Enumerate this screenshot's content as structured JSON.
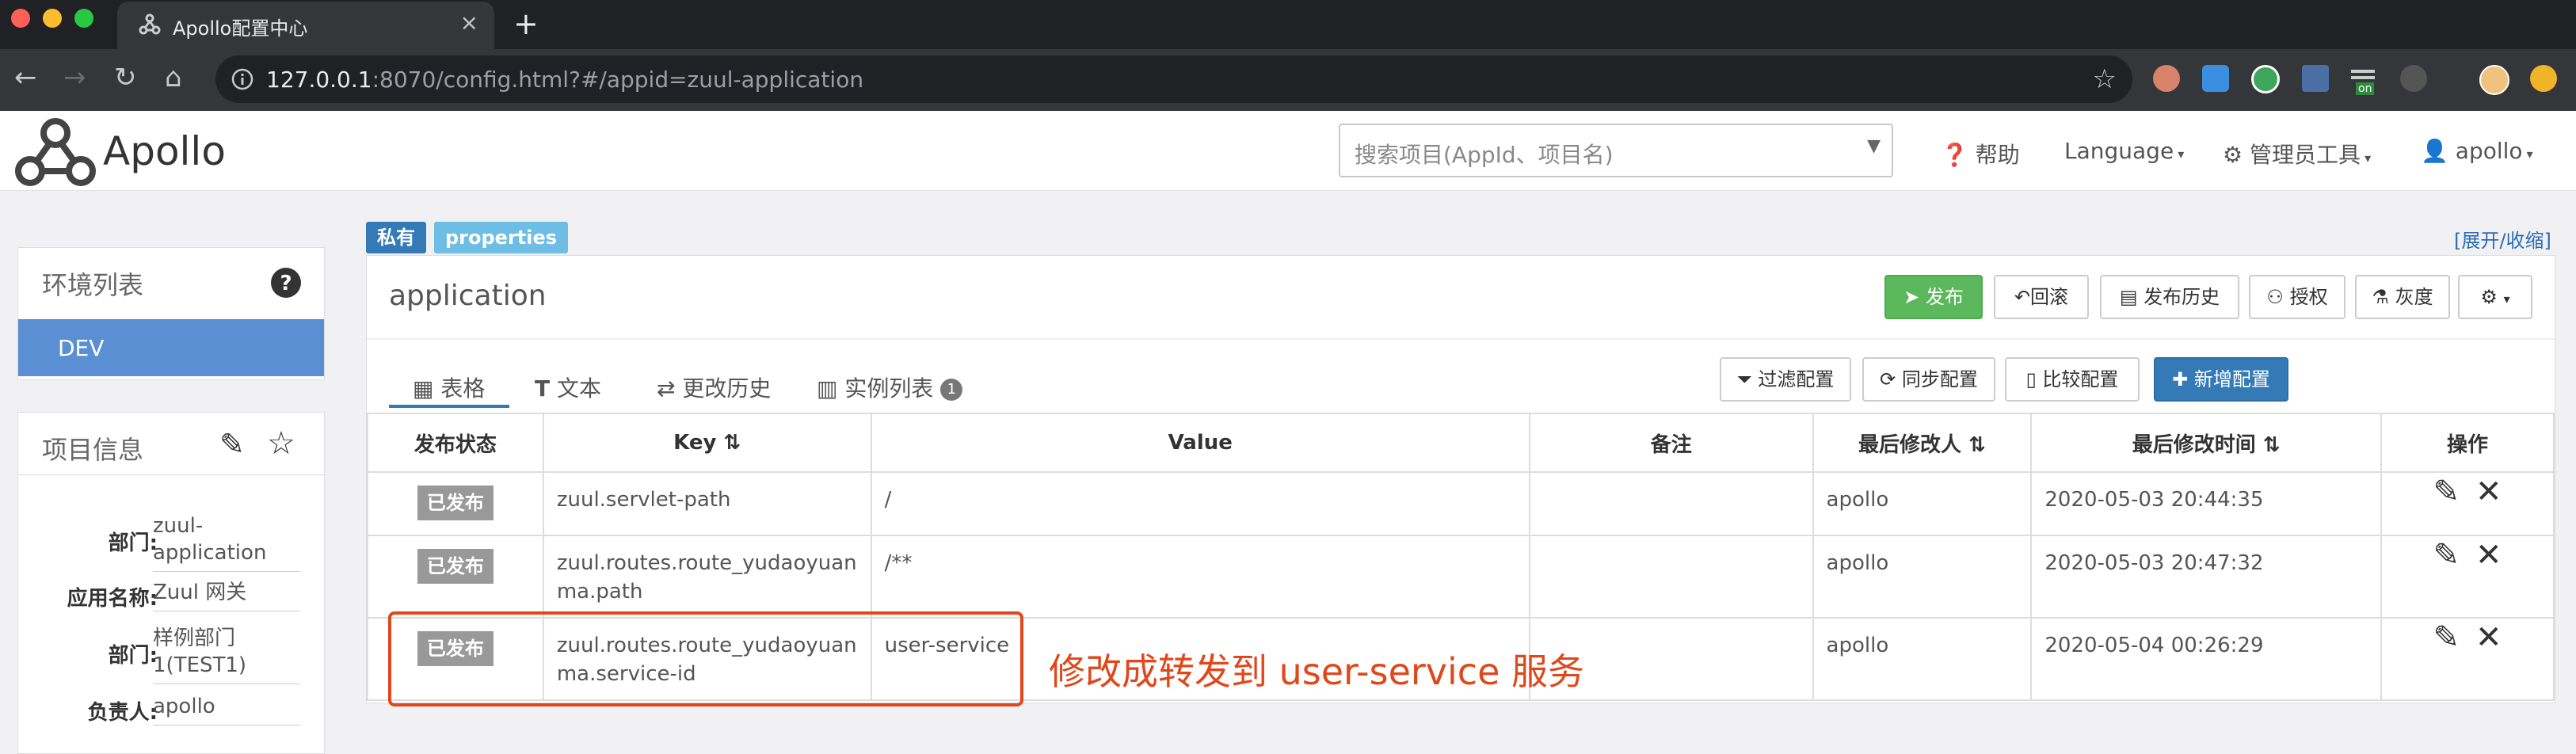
{
  "browser": {
    "tab_title": "Apollo配置中心",
    "tab_close": "×",
    "new_tab": "+",
    "url_host": "127.0.0.1",
    "url_rest": ":8070/config.html?#/appid=zuul-application",
    "ext_label_on": "on"
  },
  "header": {
    "logo": "Apollo",
    "search_placeholder": "搜索项目(AppId、项目名)",
    "help": "帮助",
    "language": "Language",
    "admin_tools": "管理员工具",
    "user": "apollo"
  },
  "env_panel": {
    "title": "环境列表",
    "items": [
      "DEV"
    ]
  },
  "project_panel": {
    "title": "项目信息",
    "fields": [
      {
        "label": "部门:",
        "value": "zuul-application"
      },
      {
        "label": "应用名称:",
        "value": "Zuul 网关"
      },
      {
        "label": "部门:",
        "value": "样例部门1(TEST1)"
      },
      {
        "label": "负责人:",
        "value": "apollo"
      }
    ]
  },
  "namespace": {
    "badges": [
      "私有",
      "properties"
    ],
    "expand_toggle": "[展开/收缩]",
    "name": "application",
    "actions": [
      "发布",
      "回滚",
      "发布历史",
      "授权",
      "灰度"
    ],
    "tabs": [
      "表格",
      "文本",
      "更改历史",
      "实例列表"
    ],
    "instance_count": "1",
    "table_actions": [
      "过滤配置",
      "同步配置",
      "比较配置",
      "新增配置"
    ]
  },
  "table": {
    "headers": [
      "发布状态",
      "Key",
      "Value",
      "备注",
      "最后修改人",
      "最后修改时间",
      "操作"
    ],
    "rows": [
      {
        "status": "已发布",
        "key": "zuul.servlet-path",
        "value": "/",
        "comment": "",
        "modifier": "apollo",
        "time": "2020-05-03 20:44:35"
      },
      {
        "status": "已发布",
        "key": "zuul.routes.route_yudaoyuanma.path",
        "value": "/**",
        "comment": "",
        "modifier": "apollo",
        "time": "2020-05-03 20:47:32"
      },
      {
        "status": "已发布",
        "key": "zuul.routes.route_yudaoyuanma.service-id",
        "value": "user-service",
        "comment": "",
        "modifier": "apollo",
        "time": "2020-05-04 00:26:29"
      }
    ]
  },
  "annotation": "修改成转发到 user-service 服务",
  "colors": {
    "accent": "#337ab7",
    "publish": "#5cb85c",
    "annotation": "#e0471b"
  }
}
